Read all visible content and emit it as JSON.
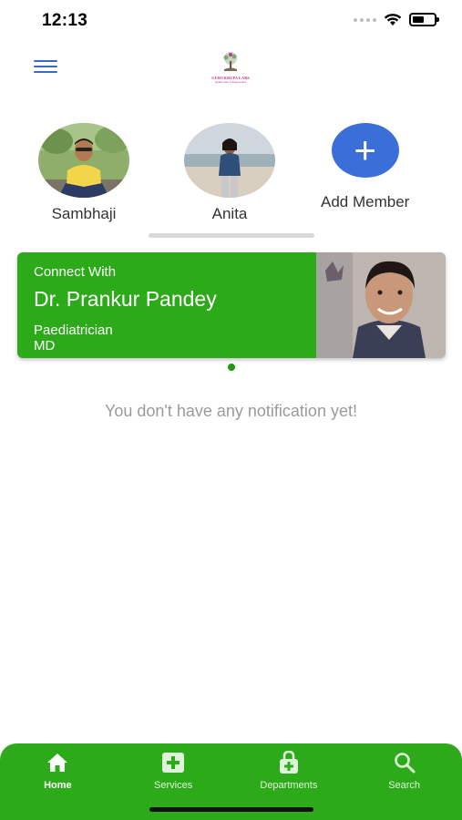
{
  "status_bar": {
    "time": "12:13"
  },
  "header": {
    "logo_title": "GURUKRUPA LABS",
    "logo_subtitle": "Health care & Diagnostics"
  },
  "members": [
    {
      "name": "Sambhaji"
    },
    {
      "name": "Anita"
    }
  ],
  "add_member": {
    "label": "Add Member"
  },
  "doctor_card": {
    "connect_label": "Connect With",
    "name": "Dr. Prankur Pandey",
    "speciality": "Paediatrician",
    "degree": "MD"
  },
  "notifications": {
    "empty_message": "You don't have any notification yet!"
  },
  "bottom_nav": {
    "items": [
      {
        "label": "Home",
        "icon": "home-icon",
        "active": true
      },
      {
        "label": "Services",
        "icon": "medical-plus-icon",
        "active": false
      },
      {
        "label": "Departments",
        "icon": "medical-bag-icon",
        "active": false
      },
      {
        "label": "Search",
        "icon": "search-icon",
        "active": false
      }
    ]
  },
  "colors": {
    "primary_green": "#2daa1a",
    "accent_blue": "#3a6fd8",
    "menu_blue": "#3b6bc4"
  }
}
